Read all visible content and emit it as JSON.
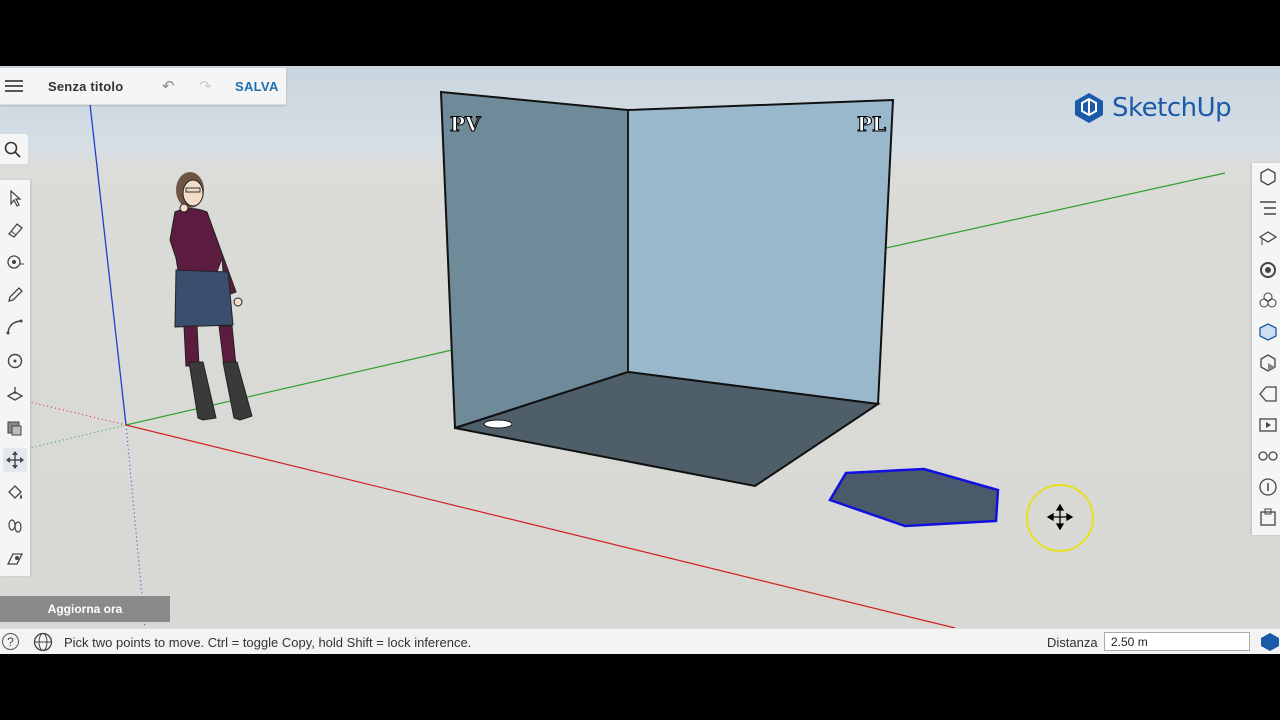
{
  "header": {
    "menu_icon": "hamburger-icon",
    "document_title": "Senza titolo",
    "undo_icon": "undo-icon",
    "redo_icon": "redo-icon",
    "save_label": "SALVA"
  },
  "brand": {
    "name": "SketchUp",
    "color": "#1b5aa8"
  },
  "left_tools": [
    {
      "name": "select-tool",
      "icon": "arrow-cursor-icon"
    },
    {
      "name": "eraser-tool",
      "icon": "eraser-icon"
    },
    {
      "name": "tape-tool",
      "icon": "tape-measure-icon"
    },
    {
      "name": "pencil-tool",
      "icon": "pencil-icon"
    },
    {
      "name": "arc-tool",
      "icon": "arc-icon"
    },
    {
      "name": "shape-tool",
      "icon": "circle-shape-icon"
    },
    {
      "name": "pushpull-tool",
      "icon": "push-pull-icon"
    },
    {
      "name": "offset-tool",
      "icon": "offset-icon"
    },
    {
      "name": "move-tool",
      "icon": "move-icon",
      "active": true
    },
    {
      "name": "paint-tool",
      "icon": "paint-bucket-icon"
    },
    {
      "name": "walk-tool",
      "icon": "footprints-icon"
    },
    {
      "name": "section-tool",
      "icon": "section-plane-icon"
    }
  ],
  "right_panels": [
    "entity-info-icon",
    "outliner-icon",
    "components-icon",
    "materials-icon",
    "styles-icon",
    "scenes-icon",
    "shadows-icon",
    "tags-icon",
    "display-icon",
    "glasses-icon",
    "info-icon",
    "solid-tools-icon"
  ],
  "scene": {
    "face_left_label": "PV",
    "face_right_label": "PL",
    "axis_colors": {
      "red": "#d02020",
      "green": "#30a030",
      "blue": "#2040d0"
    },
    "selection_color": "#1010e0",
    "cursor_highlight_color": "#e8e020"
  },
  "update_button": "Aggiorna ora",
  "status": {
    "help_icon": "help-icon",
    "globe_icon": "globe-icon",
    "hint": "Pick two points to move. Ctrl = toggle Copy, hold Shift = lock inference.",
    "measurement_label": "Distanza",
    "measurement_value": "2.50 m"
  }
}
